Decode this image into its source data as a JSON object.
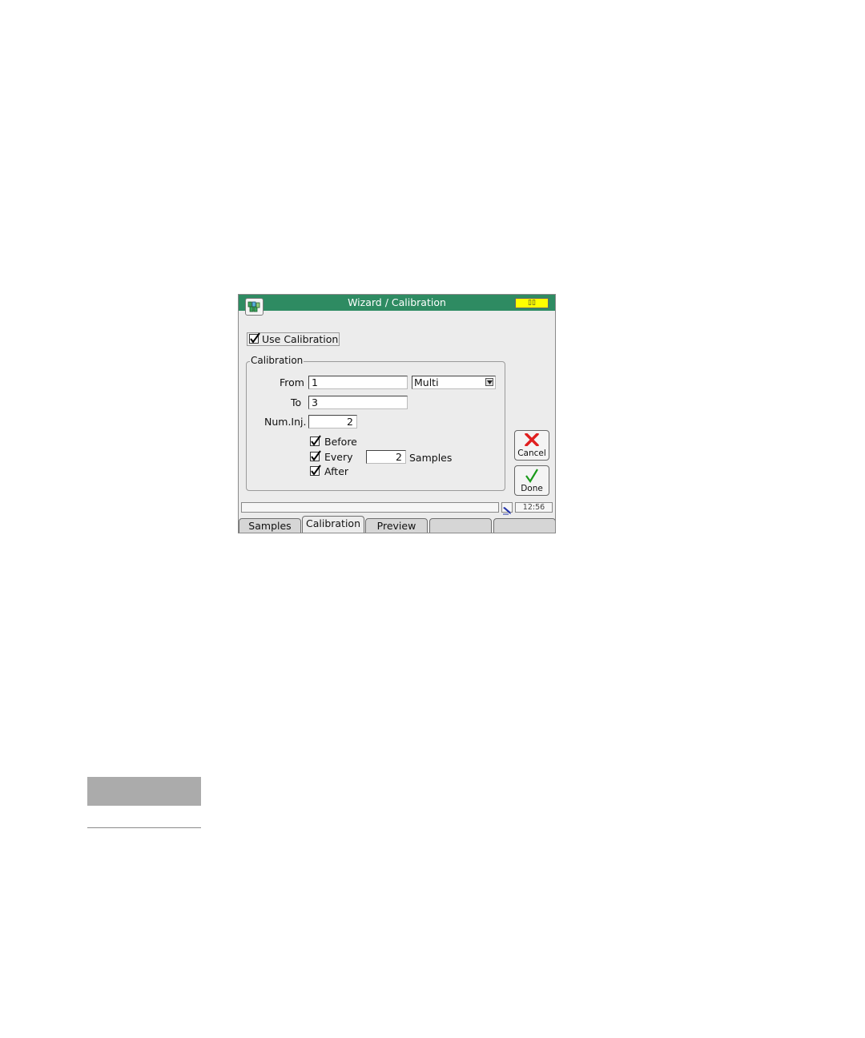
{
  "window": {
    "title": "Wizard / Calibration",
    "status_led": "▯▯"
  },
  "options": {
    "use_calibration_label": "Use Calibration",
    "use_calibration_checked": true
  },
  "calibration_group": {
    "label": "Calibration",
    "from_label": "From",
    "from_value": "1",
    "mode_value": "Multi",
    "to_label": "To",
    "to_value": "3",
    "num_inj_label": "Num.Inj.",
    "num_inj_value": "2",
    "before_label": "Before",
    "before_checked": true,
    "every_label": "Every",
    "every_checked": true,
    "every_value": "2",
    "samples_label": "Samples",
    "after_label": "After",
    "after_checked": true
  },
  "buttons": {
    "cancel_label": "Cancel",
    "done_label": "Done"
  },
  "statusbar": {
    "clock": "12:56"
  },
  "tabs": [
    {
      "label": "Samples"
    },
    {
      "label": "Calibration"
    },
    {
      "label": "Preview"
    },
    {
      "label": ""
    },
    {
      "label": ""
    }
  ],
  "colors": {
    "titlebar": "#2e8b62",
    "status_led": "#ffff00",
    "cancel_x": "#e02020",
    "done_check": "#1a9a1a"
  },
  "icons": {
    "app": "multi-vial-icon",
    "cancel": "close-icon",
    "done": "checkmark-icon",
    "status": "pen-icon"
  }
}
